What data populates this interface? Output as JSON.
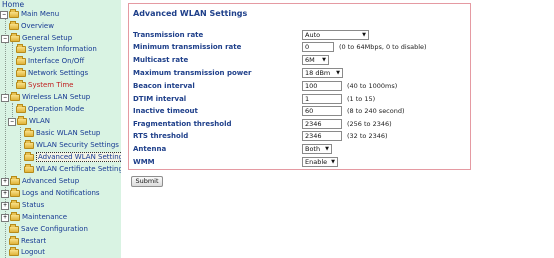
{
  "sidebar": {
    "home": "Home",
    "items": {
      "main_menu": "Main Menu",
      "overview": "Overview",
      "general_setup": "General Setup",
      "system_information": "System Information",
      "interface_onoff": "Interface On/Off",
      "network_settings": "Network Settings",
      "system_time": "System Time",
      "wireless_lan_setup": "Wireless LAN Setup",
      "operation_mode": "Operation Mode",
      "wlan": "WLAN",
      "basic_wlan_setup": "Basic WLAN Setup",
      "wlan_security_settings": "WLAN Security Settings",
      "advanced_wlan_settings": "Advanced WLAN Settings",
      "wlan_certificate_settings": "WLAN Certificate Settings",
      "advanced_setup": "Advanced Setup",
      "logs_and_notifications": "Logs and Notifications",
      "status": "Status",
      "maintenance": "Maintenance",
      "save_configuration": "Save Configuration",
      "restart": "Restart",
      "logout": "Logout"
    },
    "expanders": {
      "minus": "−",
      "plus": "+"
    }
  },
  "panel": {
    "title": "Advanced WLAN Settings",
    "fields": {
      "transmission_rate": {
        "label": "Transmission rate",
        "value": "Auto"
      },
      "min_transmission_rate": {
        "label": "Minimum transmission rate",
        "value": "0",
        "hint": "(0 to 64Mbps, 0 to disable)"
      },
      "multicast_rate": {
        "label": "Multicast rate",
        "value": "6M"
      },
      "max_transmission_power": {
        "label": "Maximum transmission power",
        "value": "18 dBm"
      },
      "beacon_interval": {
        "label": "Beacon interval",
        "value": "100",
        "hint": "(40 to 1000ms)"
      },
      "dtim_interval": {
        "label": "DTIM interval",
        "value": "1",
        "hint": "(1 to 15)"
      },
      "inactive_timeout": {
        "label": "Inactive timeout",
        "value": "60",
        "hint": "(8 to 240 second)"
      },
      "fragmentation_threshold": {
        "label": "Fragmentation threshold",
        "value": "2346",
        "hint": "(256 to 2346)"
      },
      "rts_threshold": {
        "label": "RTS threshold",
        "value": "2346",
        "hint": "(32 to 2346)"
      },
      "antenna": {
        "label": "Antenna",
        "value": "Both"
      },
      "wmm": {
        "label": "WMM",
        "value": "Enable"
      }
    }
  },
  "submit_label": "Submit",
  "colors": {
    "sidebar_bg": "#d9f3e3",
    "link": "#173a93",
    "active_link": "#c02020",
    "panel_border": "#e59aa2",
    "heading": "#1e3f8a"
  },
  "icons": {
    "folder": "folder-icon",
    "select_arrow": "triangle-down"
  }
}
